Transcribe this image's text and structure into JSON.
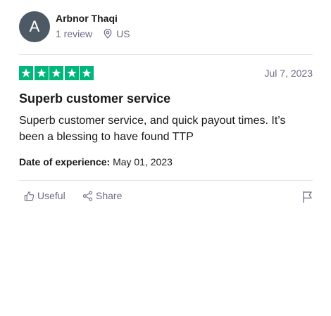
{
  "reviewer": {
    "avatar_letter": "A",
    "name": "Arbnor Thaqi",
    "review_count": "1 review",
    "location": "US"
  },
  "review": {
    "rating": 5,
    "rating_max": 5,
    "star_color": "#00b67a",
    "date": "Jul 7, 2023",
    "title": "Superb customer service",
    "body": "Superb customer service, and quick payout times. It’s been a blessing to have found TTP",
    "experience_label": "Date of experience:",
    "experience_date": "May 01, 2023"
  },
  "actions": {
    "useful_label": "Useful",
    "share_label": "Share",
    "useful_icon": "thumbs-up-icon",
    "share_icon": "share-icon",
    "flag_icon": "flag-icon"
  }
}
